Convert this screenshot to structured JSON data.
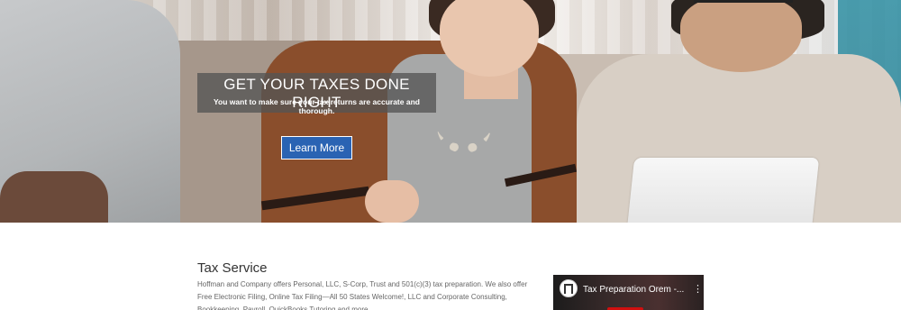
{
  "hero": {
    "title": "GET YOUR TAXES DONE RIGHT",
    "subtitle": "You want to make sure your tax returns are accurate and thorough.",
    "button_label": "Learn More",
    "colors": {
      "overlay": "#555555",
      "button": "#2a63b3"
    }
  },
  "content": {
    "heading": "Tax Service",
    "body": "Hoffman and Company offers Personal, LLC, S-Corp, Trust and 501(c)(3) tax preparation. We also offer Free Electronic Filing, Online Tax Filing—All 50 States Welcome!, LLC and Corporate Consulting, Bookkeeping, Payroll, QuickBooks Tutoring and more."
  },
  "video": {
    "title": "Tax Preparation Orem -...",
    "menu_icon": "more-vertical-icon",
    "logo_icon": "channel-logo-icon"
  }
}
